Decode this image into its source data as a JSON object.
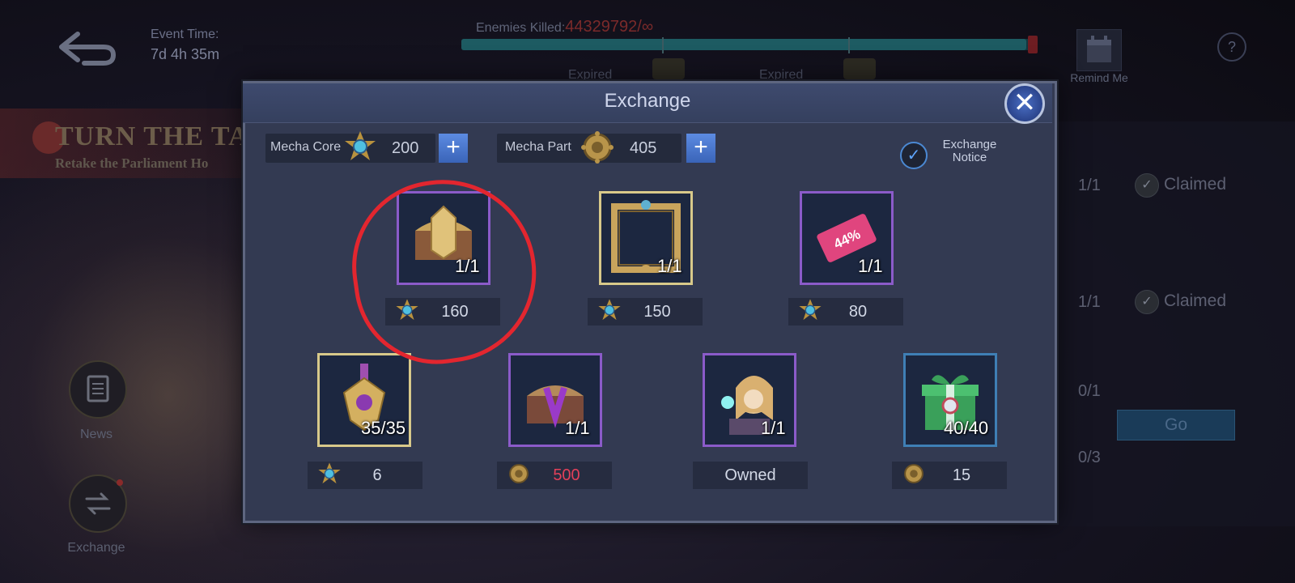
{
  "header": {
    "event_time_label": "Event Time:",
    "event_time_value": "7d 4h 35m",
    "enemies_label": "Enemies Killed:",
    "enemies_value": "44329792/∞",
    "progress_fraction": 0.98,
    "expired_labels": [
      "Expired",
      "Expired"
    ],
    "remind_label": "Remind Me",
    "help_symbol": "?"
  },
  "banner": {
    "title": "TURN THE TA",
    "subtitle": "Retake the Parliament Ho"
  },
  "side": {
    "news_label": "News",
    "exchange_label": "Exchange"
  },
  "tasks": [
    {
      "progress": "1/1",
      "status": "Claimed"
    },
    {
      "progress": "1/1",
      "status": "Claimed"
    },
    {
      "progress": "0/1",
      "status": ""
    },
    {
      "progress": "0/3",
      "status": ""
    }
  ],
  "go_label": "Go",
  "dialog": {
    "title": "Exchange",
    "close_symbol": "✕",
    "currencies": [
      {
        "label": "Mecha Core",
        "value": "200",
        "icon": "mecha-core-icon"
      },
      {
        "label": "Mecha Part",
        "value": "405",
        "icon": "mecha-part-icon"
      }
    ],
    "plus_symbol": "+",
    "notice_label": "Exchange Notice",
    "notice_checked": true,
    "items": [
      {
        "icon": "golden-chest-icon",
        "qty": "1/1",
        "price": "160",
        "currency": "mecha-core",
        "frame": "purple"
      },
      {
        "icon": "avatar-border-icon",
        "qty": "1/1",
        "price": "150",
        "currency": "mecha-core",
        "frame": "gold"
      },
      {
        "icon": "discount-ticket-icon",
        "ticket_text": "44%",
        "qty": "1/1",
        "price": "80",
        "currency": "mecha-core",
        "frame": "purple"
      },
      {
        "icon": "emblem-medal-icon",
        "qty": "35/35",
        "price": "6",
        "currency": "mecha-core",
        "frame": "gold"
      },
      {
        "icon": "purple-chest-icon",
        "qty": "1/1",
        "price": "500",
        "currency": "mecha-part",
        "frame": "purple",
        "price_color": "#e3405a"
      },
      {
        "icon": "hero-portrait-icon",
        "qty": "1/1",
        "price": "Owned",
        "currency": "",
        "frame": "purple"
      },
      {
        "icon": "green-gift-box-icon",
        "qty": "40/40",
        "price": "15",
        "currency": "mecha-part",
        "frame": "blue"
      }
    ]
  }
}
